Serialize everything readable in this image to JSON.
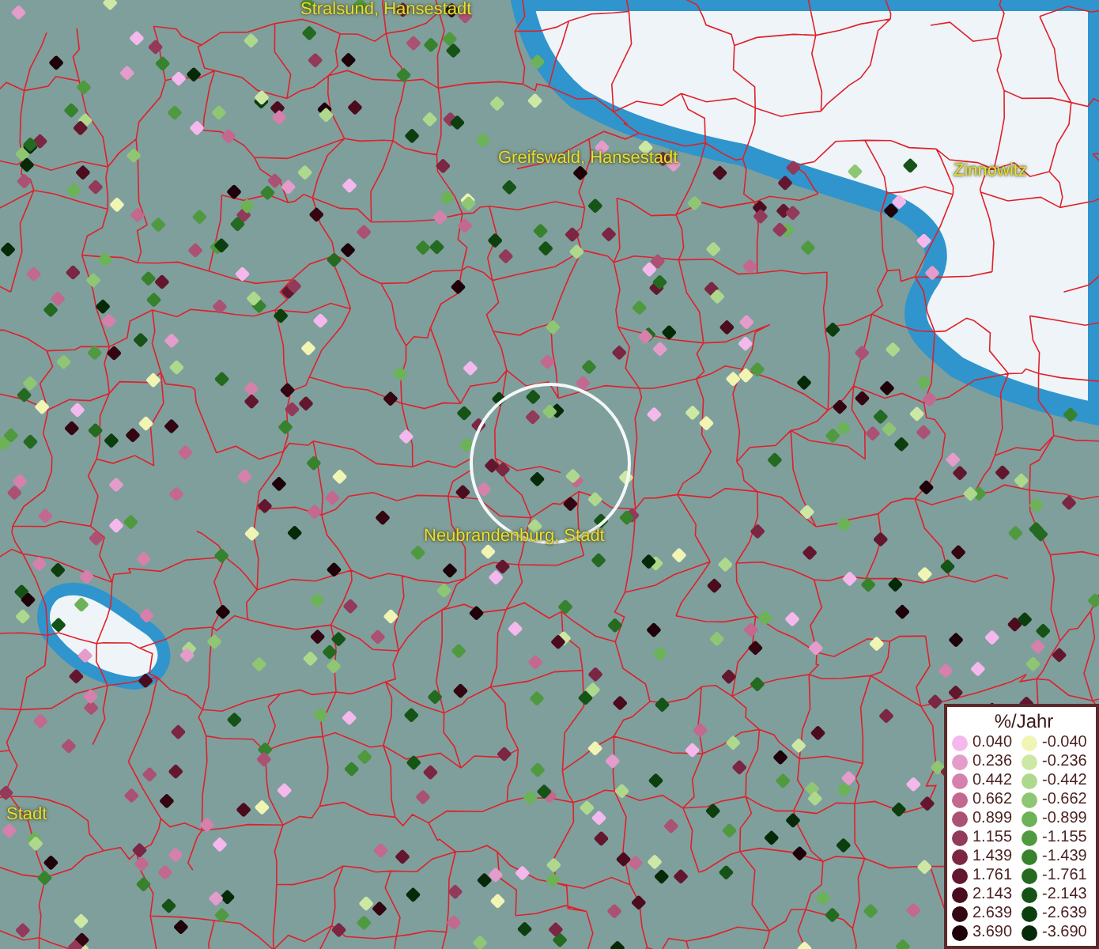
{
  "map": {
    "labels": [
      {
        "text": "Stralsund, Hansestadt"
      },
      {
        "text": "Greifswald, Hansestadt"
      },
      {
        "text": "Zinnowitz"
      },
      {
        "text": "Neubrandenburg, Stadt"
      },
      {
        "text": "Stadt"
      }
    ]
  },
  "legend": {
    "title": "%/Jahr",
    "entries": [
      {
        "value": "0.040",
        "color": "#f5b8ec"
      },
      {
        "value": "-0.040",
        "color": "#f0f5b4"
      },
      {
        "value": "0.236",
        "color": "#e49ccb"
      },
      {
        "value": "-0.236",
        "color": "#cde8a4"
      },
      {
        "value": "0.442",
        "color": "#d581ab"
      },
      {
        "value": "-0.442",
        "color": "#aed88c"
      },
      {
        "value": "0.662",
        "color": "#c3688f"
      },
      {
        "value": "-0.662",
        "color": "#8fc673"
      },
      {
        "value": "0.899",
        "color": "#ab5173"
      },
      {
        "value": "-0.899",
        "color": "#6cb257"
      },
      {
        "value": "1.155",
        "color": "#93395a"
      },
      {
        "value": "-1.155",
        "color": "#4f9a3f"
      },
      {
        "value": "1.439",
        "color": "#7b2642"
      },
      {
        "value": "-1.439",
        "color": "#37822d"
      },
      {
        "value": "1.761",
        "color": "#63172f"
      },
      {
        "value": "-1.761",
        "color": "#246a20"
      },
      {
        "value": "2.143",
        "color": "#4b0c1e"
      },
      {
        "value": "-2.143",
        "color": "#165316"
      },
      {
        "value": "2.639",
        "color": "#340612"
      },
      {
        "value": "-2.639",
        "color": "#0c3e0e"
      },
      {
        "value": "3.690",
        "color": "#1f0209"
      },
      {
        "value": "-3.690",
        "color": "#062a08"
      }
    ]
  }
}
